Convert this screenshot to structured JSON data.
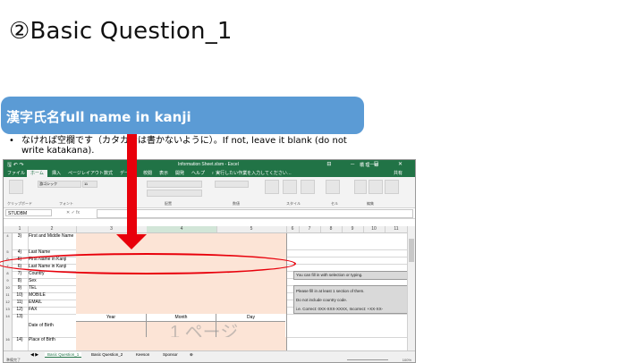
{
  "slide": {
    "title": "②Basic Question_1",
    "banner": "漢字氏名full name in kanji",
    "bullet_dot": "•",
    "bullet": "なければ空欄です（カタカナは書かないように）。If not, leave it blank (do not write katakana)."
  },
  "excel": {
    "window_title": "Information Sheet.xlsm - Excel",
    "user": "橋 理一郎",
    "window_controls": "⊟ ─ ☐ ✕",
    "quick_access": "🖫 ↶ ↷",
    "ribbon_tabs": [
      "ファイル",
      "ホーム",
      "挿入",
      "ページレイアウト",
      "数式",
      "データ",
      "校閲",
      "表示",
      "開発",
      "ヘルプ",
      "♀ 実行したい作業を入力してください…"
    ],
    "share": "共有",
    "ribbon_groups": [
      "クリップボード",
      "フォント",
      "配置",
      "数値",
      "スタイル",
      "セル",
      "編集"
    ],
    "font_name": "游ゴシック",
    "font_size": "11",
    "name_box": "STUDBM",
    "fx": "✕ ✓ fx",
    "columns": [
      "1",
      "2",
      "3",
      "4",
      "5",
      "6",
      "7",
      "8",
      "9",
      "10",
      "11"
    ],
    "rows": [
      {
        "num": "4",
        "idx": "3)",
        "label": "First and Middle Name"
      },
      {
        "num": "5",
        "idx": "4)",
        "label": "Last Name"
      },
      {
        "num": "6",
        "idx": "5)",
        "label": "First Name in Kanji"
      },
      {
        "num": "7",
        "idx": "6)",
        "label": "Last Name in Kanji"
      },
      {
        "num": "8",
        "idx": "7)",
        "label": "Country"
      },
      {
        "num": "9",
        "idx": "8)",
        "label": "Sex"
      },
      {
        "num": "10",
        "idx": "9)",
        "label": "TEL"
      },
      {
        "num": "11",
        "idx": "10)",
        "label": "MOBILE"
      },
      {
        "num": "12",
        "idx": "11)",
        "label": "EMAIL"
      },
      {
        "num": "13",
        "idx": "12)",
        "label": "FAX"
      },
      {
        "num": "14",
        "idx": "13)",
        "label": "Date of Birth"
      },
      {
        "num": "16",
        "idx": "14)",
        "label": "Place of Birth"
      }
    ],
    "date_headers": [
      "Year",
      "Month",
      "Day"
    ],
    "note1": "You can fill in with selection or typing.",
    "note2": [
      "Please fill in at least 1 section of them.",
      "Do not include country code.",
      "i.e. Correct: 0XX-XXX-XXXX, Incorrect: +XX-XX-"
    ],
    "sheet_tabs": [
      "Basic Question_1",
      "Basic Question_2",
      "Keeson",
      "Sponsor",
      "⊕"
    ],
    "status_left": "準備完了",
    "zoom": "100%",
    "watermark": "1 ページ"
  }
}
